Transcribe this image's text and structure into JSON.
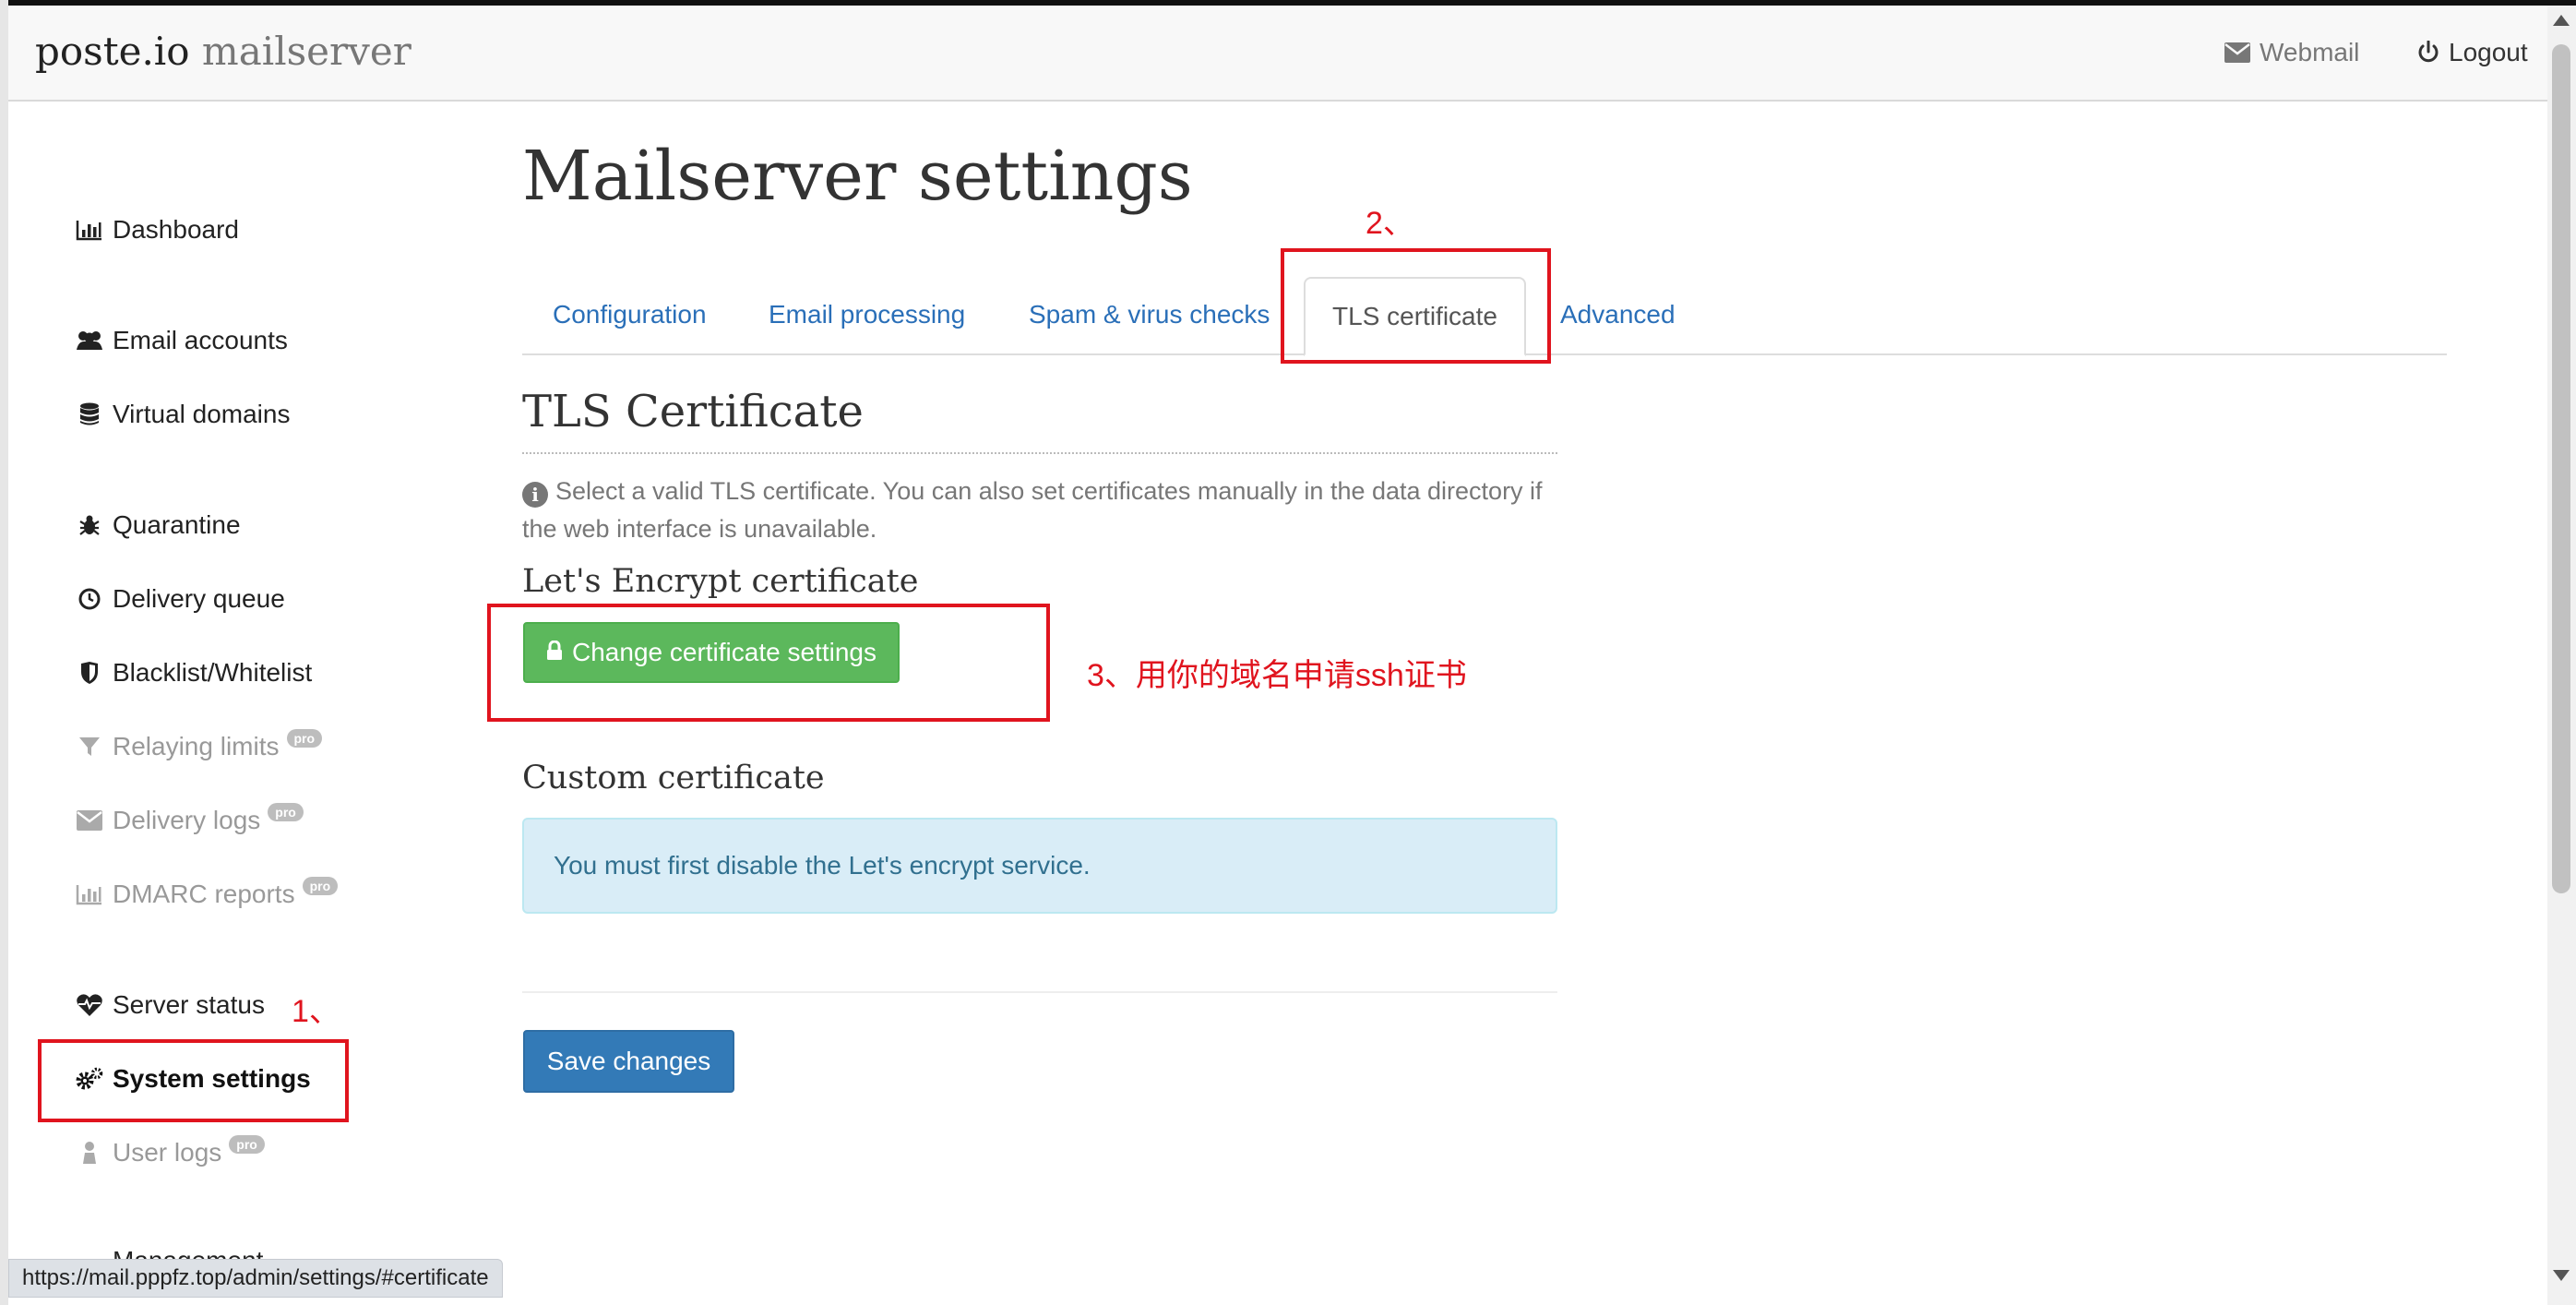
{
  "brand": {
    "name": "poste.io",
    "suffix": "mailserver"
  },
  "header": {
    "webmail_label": "Webmail",
    "logout_label": "Logout"
  },
  "sidebar": {
    "items": [
      {
        "label": "Dashboard",
        "icon": "bar-chart-icon"
      },
      {
        "label": "Email accounts",
        "icon": "users-icon"
      },
      {
        "label": "Virtual domains",
        "icon": "database-icon"
      },
      {
        "label": "Quarantine",
        "icon": "bug-icon"
      },
      {
        "label": "Delivery queue",
        "icon": "clock-icon"
      },
      {
        "label": "Blacklist/Whitelist",
        "icon": "shield-icon"
      },
      {
        "label": "Relaying limits",
        "icon": "filter-icon",
        "badge": "pro"
      },
      {
        "label": "Delivery logs",
        "icon": "envelope-icon",
        "badge": "pro"
      },
      {
        "label": "DMARC reports",
        "icon": "bar-chart-icon",
        "badge": "pro"
      },
      {
        "label": "Server status",
        "icon": "heartbeat-icon"
      },
      {
        "label": "System settings",
        "icon": "gears-icon"
      },
      {
        "label": "User logs",
        "icon": "user-icon",
        "badge": "pro"
      },
      {
        "label": "Management",
        "icon": "wrench-icon"
      }
    ]
  },
  "annotations": {
    "step1": "1、",
    "step2": "2、",
    "step3": "3、用你的域名申请ssh证书"
  },
  "main": {
    "title": "Mailserver settings",
    "tabs": [
      {
        "label": "Configuration"
      },
      {
        "label": "Email processing"
      },
      {
        "label": "Spam & virus checks"
      },
      {
        "label": "TLS certificate",
        "active": true
      },
      {
        "label": "Advanced"
      }
    ],
    "section_title": "TLS Certificate",
    "help_text": "Select a valid TLS certificate. You can also set certificates manually in the data directory if the web interface is unavailable.",
    "letsencrypt": {
      "title": "Let's Encrypt certificate",
      "button_label": "Change certificate settings"
    },
    "custom": {
      "title": "Custom certificate",
      "alert": "You must first disable the Let's encrypt service."
    },
    "save_label": "Save changes"
  },
  "status_bar": {
    "url": "https://mail.pppfz.top/admin/settings/#certificate"
  },
  "colors": {
    "accent_link": "#2a6fb8",
    "success": "#5cb85c",
    "primary": "#337ab7",
    "annotation_red": "#e0141e",
    "alert_info_bg": "#d9edf7"
  }
}
